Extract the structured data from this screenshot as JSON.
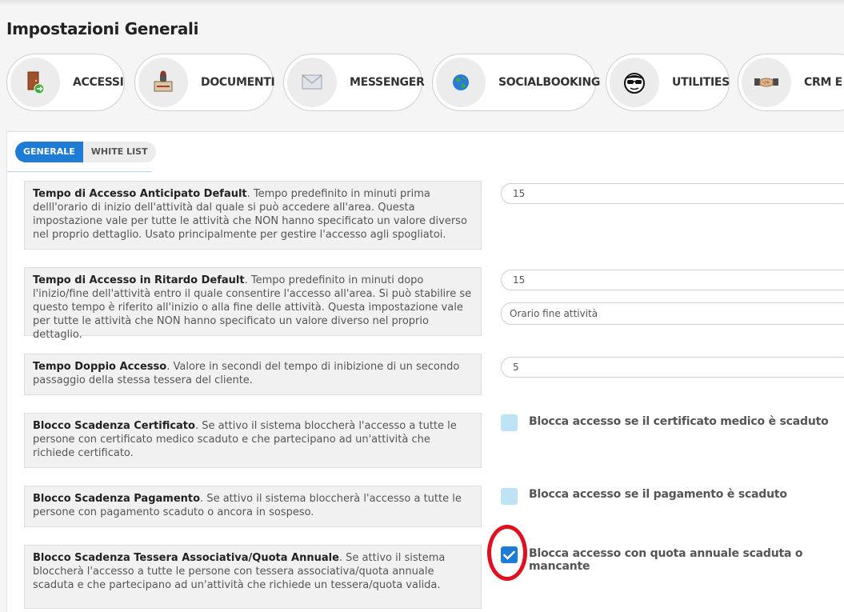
{
  "page": {
    "title": "Impostazioni Generali"
  },
  "nav": [
    {
      "label": "ACCESSI",
      "icon": "door-exit-icon"
    },
    {
      "label": "DOCUMENTI",
      "icon": "documents-stamp-icon"
    },
    {
      "label": "MESSENGER",
      "icon": "envelope-icon"
    },
    {
      "label": "SOCIALBOOKING",
      "icon": "globe-icon"
    },
    {
      "label": "UTILITIES",
      "icon": "sunglasses-face-icon"
    },
    {
      "label": "CRM E N",
      "icon": "handshake-icon"
    }
  ],
  "tabs": [
    {
      "label": "GENERALE",
      "active": true
    },
    {
      "label": "WHITE LIST",
      "active": false
    }
  ],
  "settings": [
    {
      "title": "Tempo di Accesso Anticipato Default",
      "desc": ". Tempo predefinito in minuti prima delll'orario di inizio dell'attività dal quale si può accedere all'area. Questa impostazione vale per tutte le attività che NON hanno specificato un valore diverso nel proprio dettaglio. Usato principalmente per gestire l'accesso agli spogliatoi.",
      "value": "15"
    },
    {
      "title": "Tempo di Accesso in Ritardo Default",
      "desc": ". Tempo predefinito in minuti dopo l'inizio/fine dell'attività entro il quale consentire l'accesso all'area. Si può stabilire se questo tempo è riferito all'inizio o alla fine delle attività. Questa impostazione vale per tutte le attività che NON hanno specificato un valore diverso nel proprio dettaglio.",
      "value": "15",
      "select_value": "Orario fine attività"
    },
    {
      "title": "Tempo Doppio Accesso",
      "desc": ". Valore in secondi del tempo di inibizione di un secondo passaggio della stessa tessera del cliente.",
      "value": "5"
    },
    {
      "title": "Blocco Scadenza Certificato",
      "desc": ". Se attivo il sistema bloccherà l'accesso a tutte le persone con certificato medico scaduto e che partecipano ad un'attività che richiede certificato.",
      "checkbox_label": "Blocca accesso se il certificato medico è scaduto",
      "checked": false
    },
    {
      "title": "Blocco Scadenza Pagamento",
      "desc": ". Se attivo il sistema bloccherà l'accesso a tutte le persone con pagamento scaduto o ancora in sospeso.",
      "checkbox_label": "Blocca accesso se il pagamento è scaduto",
      "checked": false
    },
    {
      "title": "Blocco Scadenza Tessera Associativa/Quota Annuale",
      "desc": ". Se attivo il sistema bloccherà l'accesso a tutte le persone con tessera associativa/quota annuale scaduta e che partecipano ad un'attività che richiede un tessera/quota valida.",
      "checkbox_label": "Blocca accesso con quota annuale scaduta o mancante",
      "checked": true
    }
  ],
  "colors": {
    "accent": "#1e7bd6",
    "checkbox_off": "#bde3f4",
    "highlight": "#e01020"
  }
}
